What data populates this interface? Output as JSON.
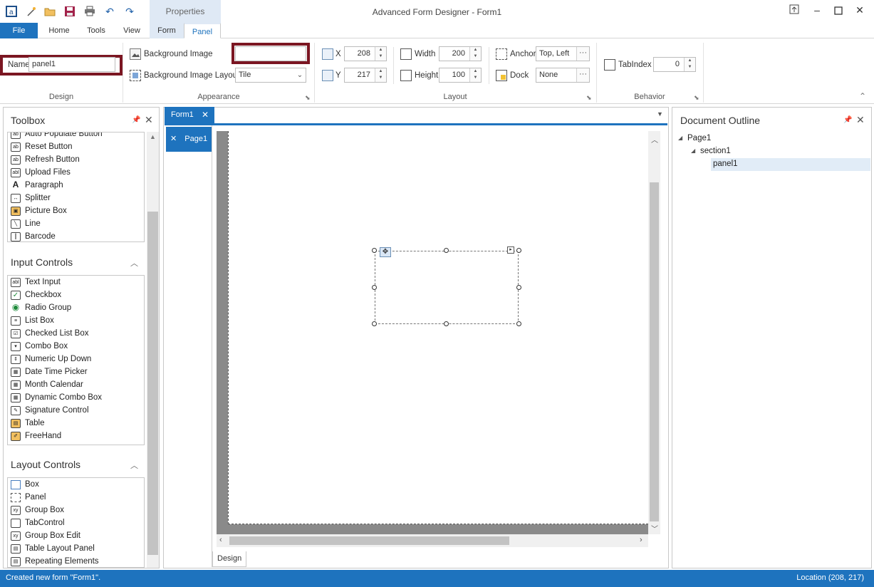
{
  "app": {
    "title": "Advanced Form Designer - Form1",
    "context_tab_group": "Properties"
  },
  "ribbon_tabs": [
    "File",
    "Home",
    "Tools",
    "View",
    "Form",
    "Panel"
  ],
  "ribbon": {
    "design": {
      "group_label": "Design",
      "name_label": "Name",
      "name_value": "panel1"
    },
    "appearance": {
      "group_label": "Appearance",
      "bg_image_label": "Background Image",
      "bg_image_value": "",
      "bg_layout_label": "Background Image Layout",
      "bg_layout_value": "Tile"
    },
    "layout": {
      "group_label": "Layout",
      "x_label": "X",
      "x_value": "208",
      "y_label": "Y",
      "y_value": "217",
      "width_label": "Width",
      "width_value": "200",
      "height_label": "Height",
      "height_value": "100",
      "anchor_label": "Anchor",
      "anchor_value": "Top, Left",
      "dock_label": "Dock",
      "dock_value": "None"
    },
    "behavior": {
      "group_label": "Behavior",
      "tabindex_label": "TabIndex",
      "tabindex_value": "0"
    }
  },
  "toolbox": {
    "title": "Toolbox",
    "top_items": [
      {
        "label": "Auto Populate Button",
        "icon": "ab-button-icon"
      },
      {
        "label": "Reset Button",
        "icon": "ab-button-icon"
      },
      {
        "label": "Refresh Button",
        "icon": "ab-button-icon"
      },
      {
        "label": "Upload Files",
        "icon": "abl-textbox-icon"
      },
      {
        "label": "Paragraph",
        "icon": "letter-a-icon"
      },
      {
        "label": "Splitter",
        "icon": "splitter-arrows-icon"
      },
      {
        "label": "Picture Box",
        "icon": "picture-icon"
      },
      {
        "label": "Line",
        "icon": "line-icon"
      },
      {
        "label": "Barcode",
        "icon": "barcode-icon"
      }
    ],
    "input_controls_title": "Input Controls",
    "input_controls": [
      {
        "label": "Text Input",
        "icon": "abl-textbox-icon"
      },
      {
        "label": "Checkbox",
        "icon": "checkbox-icon"
      },
      {
        "label": "Radio Group",
        "icon": "radio-icon"
      },
      {
        "label": "List Box",
        "icon": "listbox-icon"
      },
      {
        "label": "Checked List Box",
        "icon": "checked-listbox-icon"
      },
      {
        "label": "Combo Box",
        "icon": "combobox-icon"
      },
      {
        "label": "Numeric Up Down",
        "icon": "numeric-updown-icon"
      },
      {
        "label": "Date Time Picker",
        "icon": "datetime-icon"
      },
      {
        "label": "Month Calendar",
        "icon": "calendar-icon"
      },
      {
        "label": "Dynamic Combo Box",
        "icon": "dynamic-combobox-icon"
      },
      {
        "label": "Signature Control",
        "icon": "signature-icon"
      },
      {
        "label": "Table",
        "icon": "table-icon"
      },
      {
        "label": "FreeHand",
        "icon": "freehand-icon"
      }
    ],
    "layout_controls_title": "Layout Controls",
    "layout_controls": [
      {
        "label": "Box",
        "icon": "box-icon"
      },
      {
        "label": "Panel",
        "icon": "panel-icon"
      },
      {
        "label": "Group Box",
        "icon": "groupbox-icon"
      },
      {
        "label": "TabControl",
        "icon": "tabcontrol-icon"
      },
      {
        "label": "Group Box Edit",
        "icon": "groupbox-edit-icon"
      },
      {
        "label": "Table Layout Panel",
        "icon": "table-layout-icon"
      },
      {
        "label": "Repeating Elements",
        "icon": "repeating-icon"
      }
    ]
  },
  "designer": {
    "doc_tab": "Form1",
    "page_tab": "Page1",
    "bottom_tab": "Design"
  },
  "outline": {
    "title": "Document Outline",
    "nodes": [
      {
        "label": "Page1"
      },
      {
        "label": "section1"
      },
      {
        "label": "panel1"
      }
    ]
  },
  "status": {
    "message": "Created new form \"Form1\".",
    "location": "Location (208, 217)"
  },
  "colors": {
    "accent": "#1e73be",
    "highlight_box": "#7b1622",
    "canvas_gray": "#8a8a8a"
  }
}
